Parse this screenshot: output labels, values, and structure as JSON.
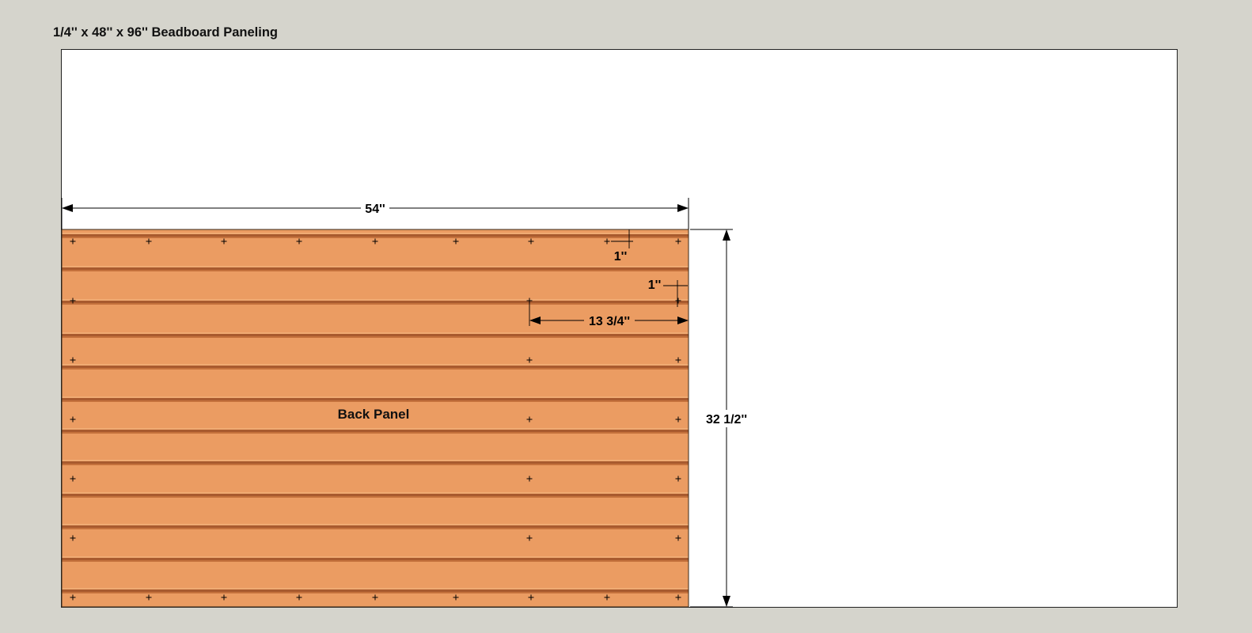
{
  "sheet": {
    "title": "1/4'' x 48'' x 96'' Beadboard Paneling"
  },
  "panel": {
    "label": "Back Panel",
    "colors": {
      "wood": "#e9995f",
      "wood_light": "#f0ab73",
      "groove_dark": "#a85a2e",
      "groove_mid": "#c4713c"
    }
  },
  "dimensions": {
    "width": "54''",
    "height": "32 1/2''",
    "nail_inset_top": "1''",
    "nail_inset_side": "1''",
    "nail_spacing": "13 3/4''"
  },
  "colors": {
    "background": "#d5d4cc",
    "sheet": "#ffffff",
    "line": "#000000"
  }
}
